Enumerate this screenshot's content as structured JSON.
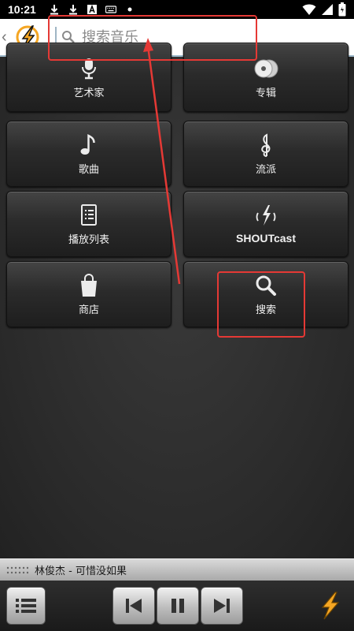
{
  "status_bar": {
    "time": "10:21",
    "icons": [
      "download-icon",
      "download-icon",
      "text-a-icon",
      "keyboard-icon",
      "dot-icon",
      "wifi-icon",
      "signal-icon",
      "battery-icon"
    ]
  },
  "header": {
    "search_placeholder": "搜索音乐",
    "search_value": ""
  },
  "tiles": [
    {
      "label": "艺术家",
      "icon": "microphone-icon"
    },
    {
      "label": "专辑",
      "icon": "album-icon"
    },
    {
      "label": "歌曲",
      "icon": "music-note-icon"
    },
    {
      "label": "流派",
      "icon": "treble-clef-icon"
    },
    {
      "label": "播放列表",
      "icon": "playlist-document-icon"
    },
    {
      "label": "SHOUTcast",
      "icon": "broadcast-icon"
    },
    {
      "label": "商店",
      "icon": "shopping-bag-icon"
    },
    {
      "label": "搜索",
      "icon": "magnifier-icon"
    }
  ],
  "now_playing": {
    "text": "林俊杰 - 可惜没如果"
  },
  "controls": {
    "icons": [
      "list-icon",
      "previous-icon",
      "pause-icon",
      "next-icon",
      "winamp-bolt-icon"
    ]
  },
  "colors": {
    "annotation": "#e53935",
    "logo_orange": "#f5a623"
  }
}
